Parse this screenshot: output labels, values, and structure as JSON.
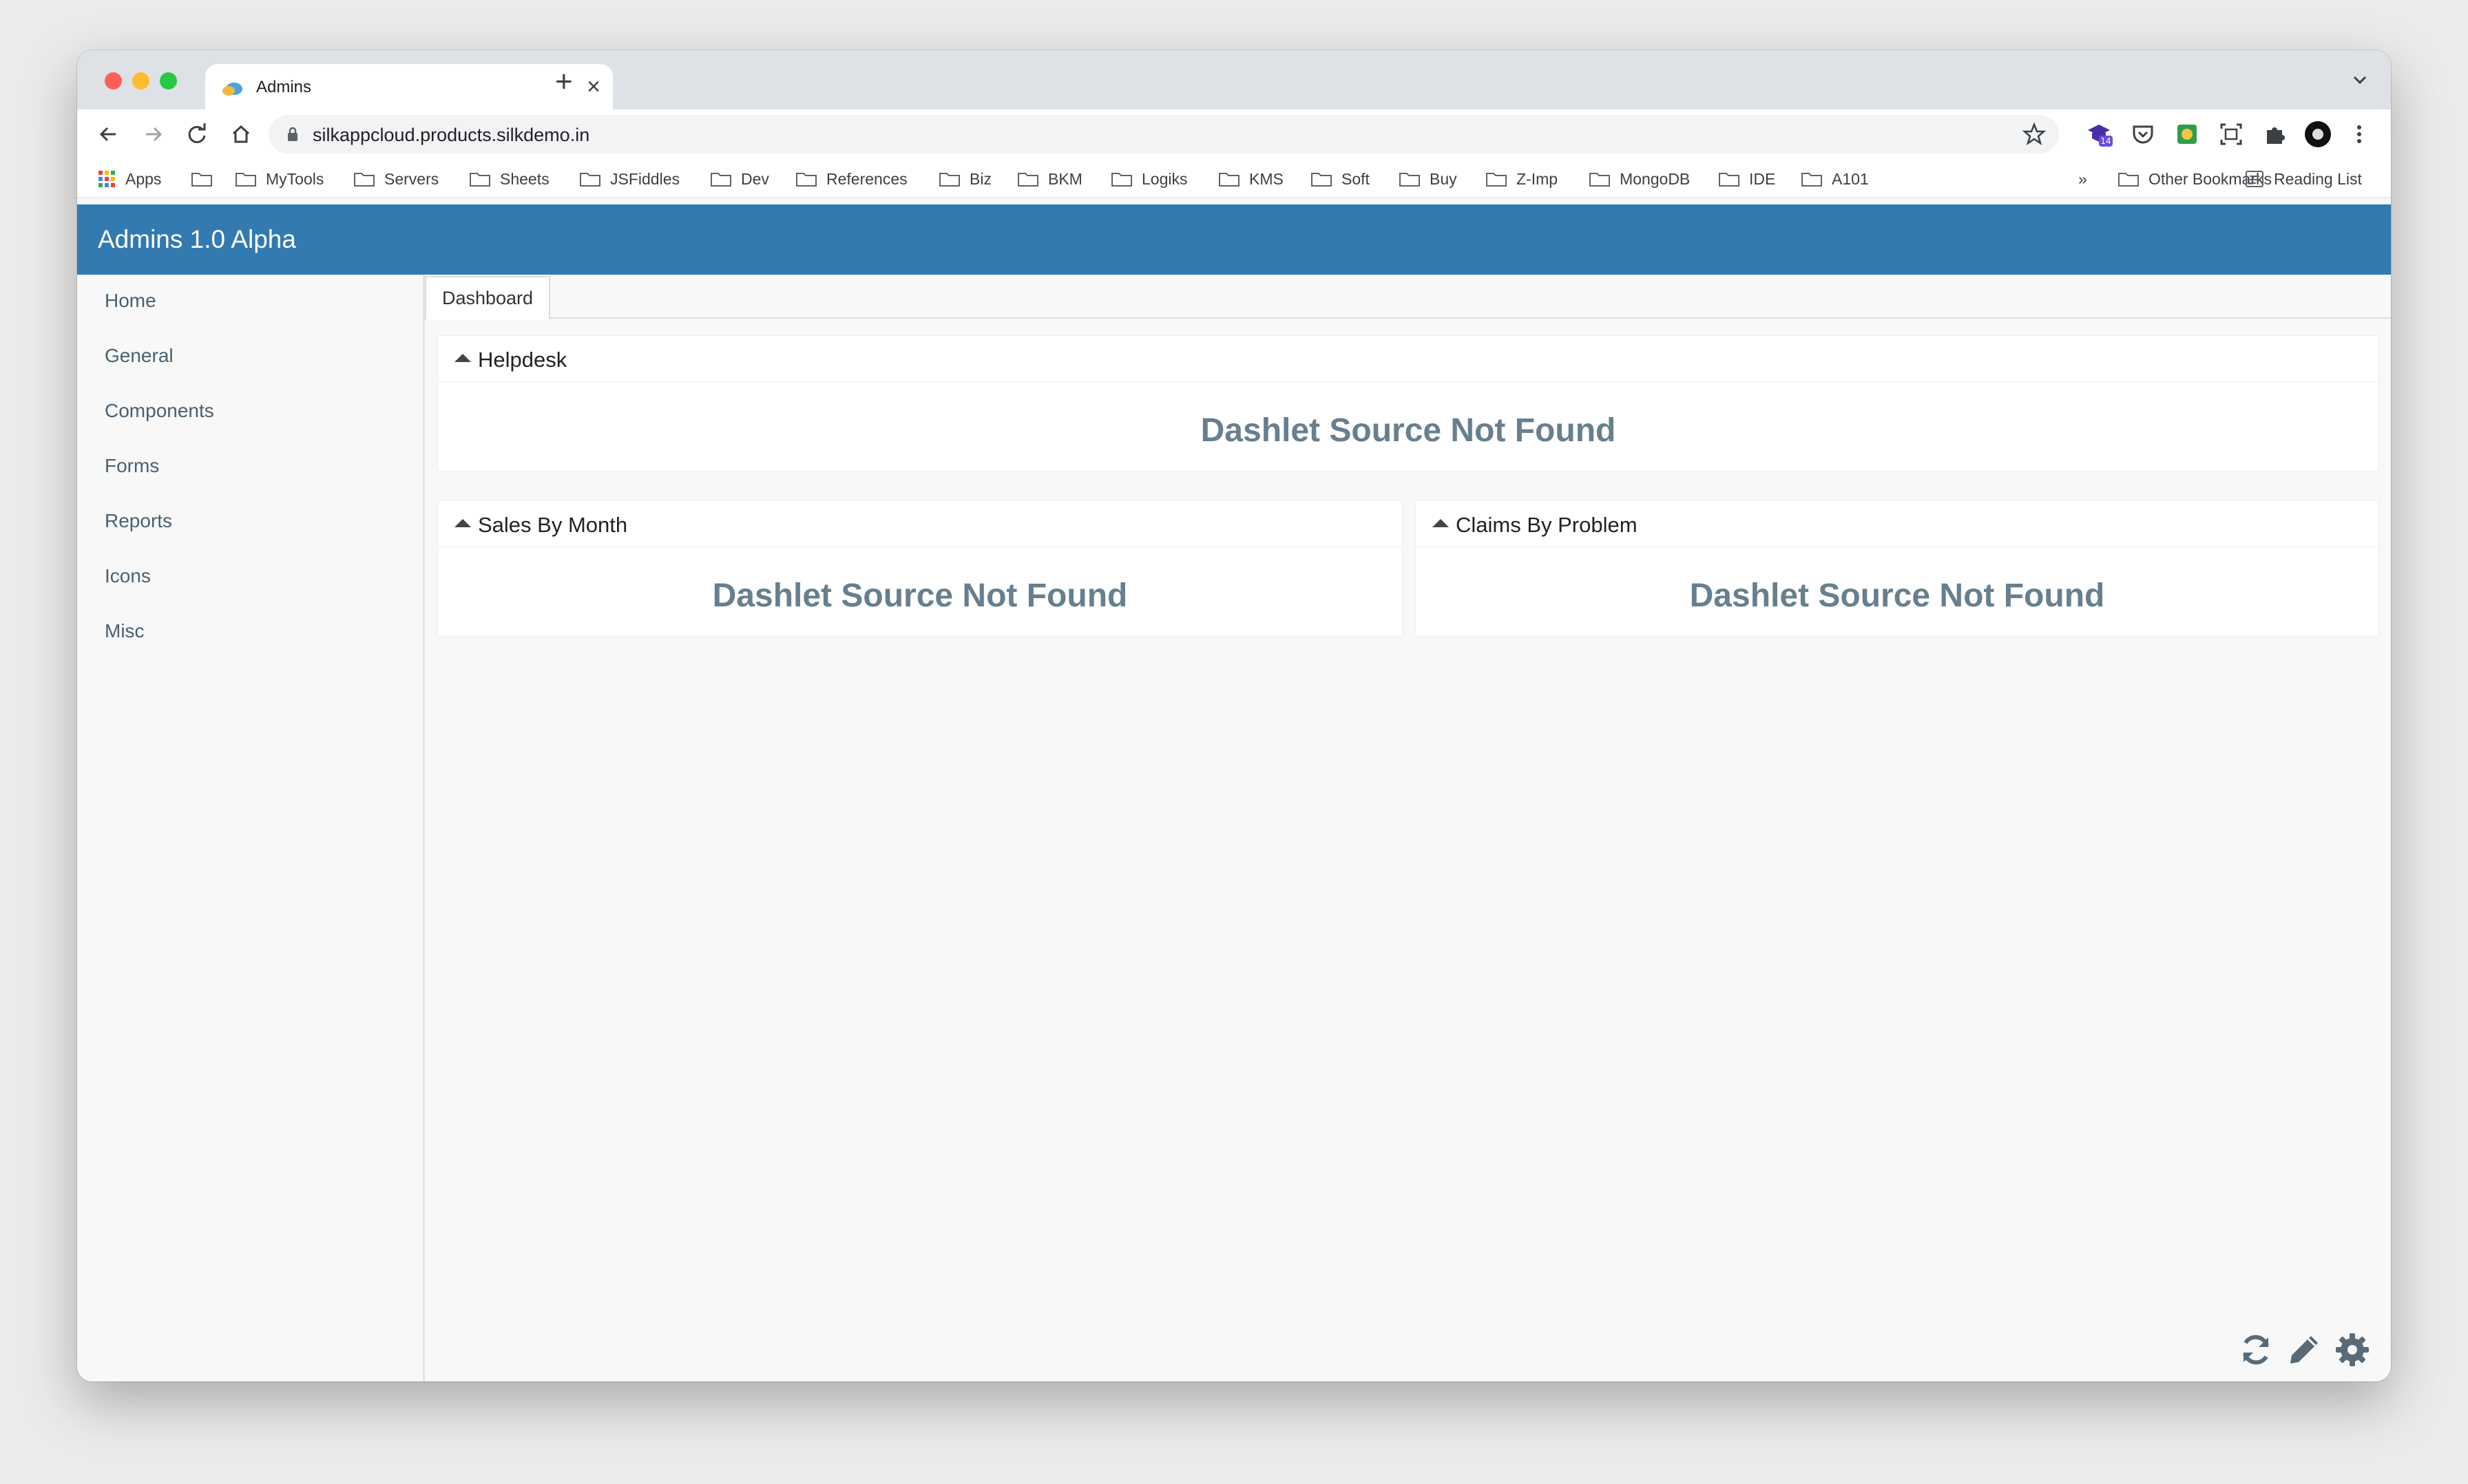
{
  "browser": {
    "tab_title": "Admins",
    "url": "silkappcloud.products.silkdemo.in",
    "extension_badge": "14"
  },
  "bookmarks": {
    "apps_label": "Apps",
    "items": [
      "MyTools",
      "Servers",
      "Sheets",
      "JSFiddles",
      "Dev",
      "References",
      "Biz",
      "BKM",
      "Logiks",
      "KMS",
      "Soft",
      "Buy",
      "Z-Imp",
      "MongoDB",
      "IDE",
      "A101"
    ],
    "overflow": "»",
    "other_bookmarks": "Other Bookmarks",
    "reading_list": "Reading List"
  },
  "app": {
    "title": "Admins 1.0 Alpha",
    "accent": "#337ab0"
  },
  "sidebar": {
    "items": [
      "Home",
      "General",
      "Components",
      "Forms",
      "Reports",
      "Icons",
      "Misc"
    ]
  },
  "content": {
    "active_tab": "Dashboard",
    "dashlets": [
      {
        "title": "Helpdesk",
        "message": "Dashlet Source Not Found"
      },
      {
        "title": "Sales By Month",
        "message": "Dashlet Source Not Found"
      },
      {
        "title": "Claims By Problem",
        "message": "Dashlet Source Not Found"
      }
    ]
  },
  "icons": {
    "footer": [
      "refresh-icon",
      "pencil-icon",
      "gear-icon"
    ]
  }
}
